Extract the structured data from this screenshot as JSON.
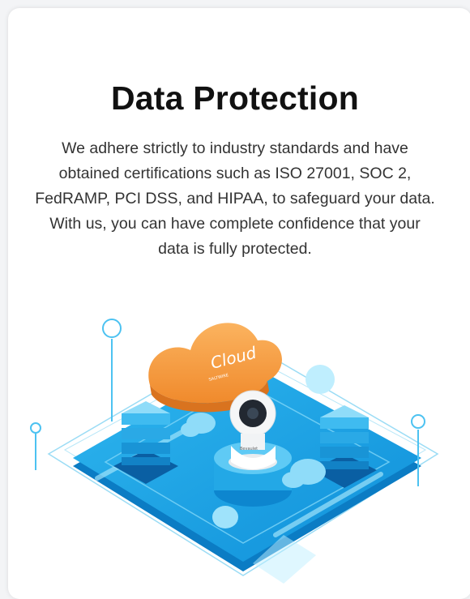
{
  "card": {
    "title": "Data Protection",
    "description": "We adhere strictly to industry standards and have obtained certifications such as ISO 27001, SOC 2, FedRAMP, PCI DSS, and HIPAA, to safeguard your data. With us, you can have complete confidence that your data is fully protected."
  },
  "illustration": {
    "cloud_label": "Cloud",
    "cloud_sublabel": "SALTWIRE",
    "camera_brand": "Bevaulet",
    "colors": {
      "platform_blue": "#1aa7e6",
      "platform_light": "#6fd3f7",
      "cloud_orange": "#f89a3c",
      "outline_blue": "#6cc9ef"
    }
  }
}
